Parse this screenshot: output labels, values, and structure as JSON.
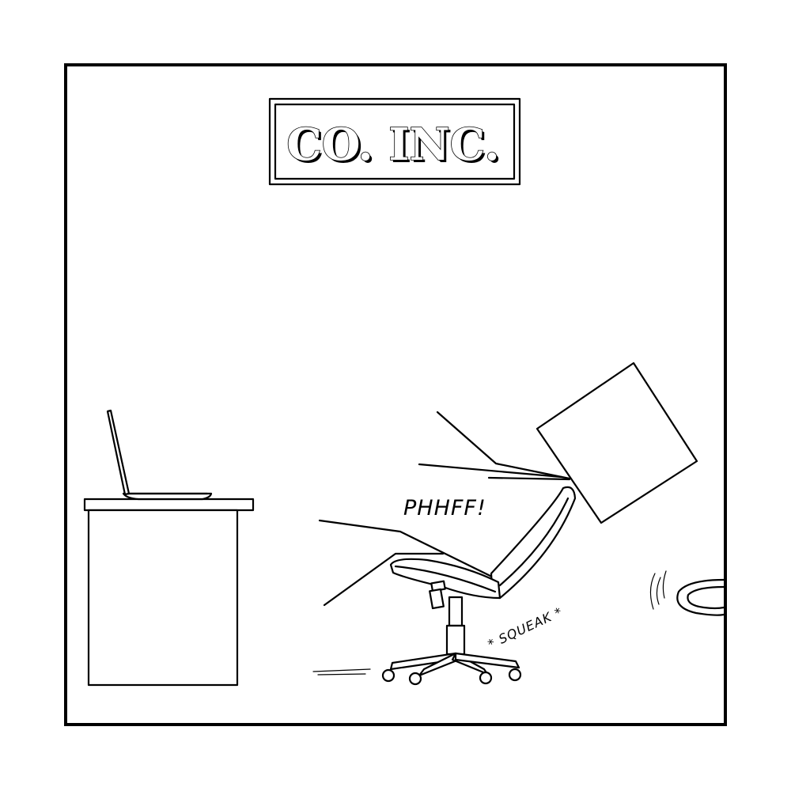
{
  "sign": {
    "text": "CO. INC."
  },
  "sound_effects": {
    "exclamation": "PHHFF!",
    "squeak": "* SQUEAK *"
  }
}
